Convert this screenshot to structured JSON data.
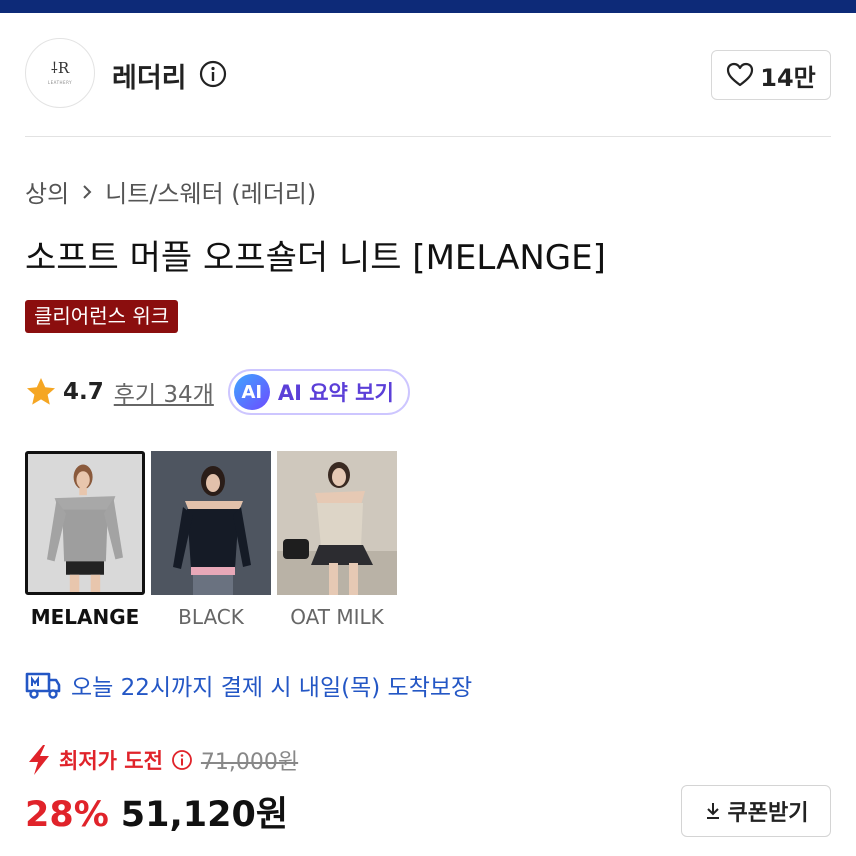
{
  "store": {
    "name": "레더리",
    "logo_mark": "⸸R",
    "logo_sub": "LEATHERY",
    "like_count": "14만"
  },
  "breadcrumb": {
    "category": "상의",
    "subcategory": "니트/스웨터 (레더리)"
  },
  "product": {
    "title": "소프트 머플 오프숄더 니트 [MELANGE]",
    "badge": "클리어런스 위크",
    "rating": "4.7",
    "reviews": "후기 34개",
    "ai_badge": "AI",
    "ai_label": "AI 요약 보기"
  },
  "variants": [
    {
      "label": "MELANGE",
      "selected": true
    },
    {
      "label": "BLACK",
      "selected": false
    },
    {
      "label": "OAT MILK",
      "selected": false
    }
  ],
  "delivery": {
    "text": "오늘 22시까지 결제 시 내일(목) 도착보장"
  },
  "price": {
    "lowest_label": "최저가 도전",
    "original": "71,000원",
    "discount": "28%",
    "sale": "51,120원",
    "coupon_label": "쿠폰받기"
  },
  "colors": {
    "brand_navy": "#0d2a78",
    "badge_red": "#8b0e0e",
    "sale_red": "#e0232a",
    "delivery_blue": "#2457c5",
    "ai_purple": "#5b3fd8",
    "star": "#f5a623"
  },
  "icons": {
    "info": "info-icon",
    "heart": "heart-icon",
    "chevron": "chevron-right-icon",
    "star": "star-icon",
    "truck": "truck-icon",
    "bolt": "lightning-icon",
    "download": "download-icon"
  }
}
